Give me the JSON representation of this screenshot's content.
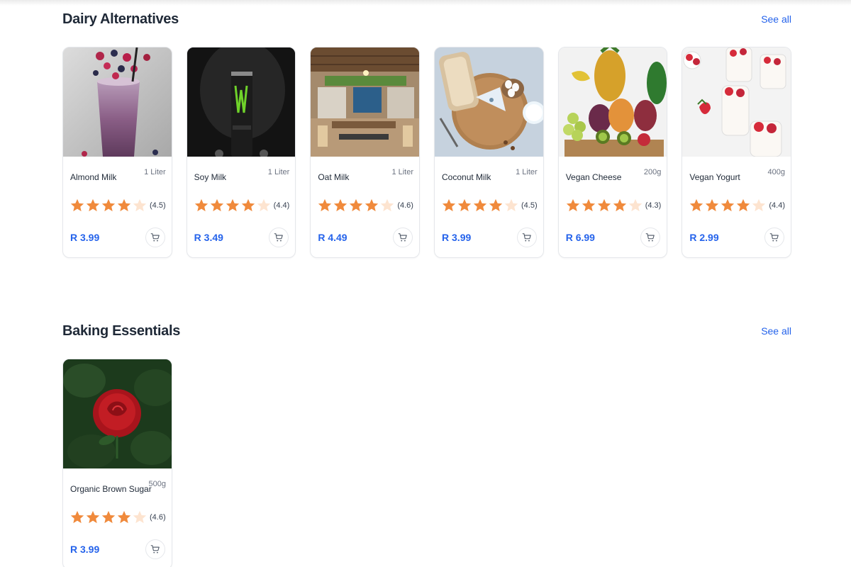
{
  "sections": [
    {
      "title": "Dairy Alternatives",
      "see_all": "See all",
      "products": [
        {
          "name": "Almond Milk",
          "size": "1 Liter",
          "rating": 4.5,
          "rating_label": "(4.5)",
          "price": "R 3.99",
          "image": "berry-smoothie"
        },
        {
          "name": "Soy Milk",
          "size": "1 Liter",
          "rating": 4.4,
          "rating_label": "(4.4)",
          "price": "R 3.49",
          "image": "energy-drink-can"
        },
        {
          "name": "Oat Milk",
          "size": "1 Liter",
          "rating": 4.6,
          "rating_label": "(4.6)",
          "price": "R 4.49",
          "image": "cafe-interior"
        },
        {
          "name": "Coconut Milk",
          "size": "1 Liter",
          "rating": 4.5,
          "rating_label": "(4.5)",
          "price": "R 3.99",
          "image": "bread-cheese-board"
        },
        {
          "name": "Vegan Cheese",
          "size": "200g",
          "rating": 4.3,
          "rating_label": "(4.3)",
          "price": "R 6.99",
          "image": "fruit-basket"
        },
        {
          "name": "Vegan Yogurt",
          "size": "400g",
          "rating": 4.4,
          "rating_label": "(4.4)",
          "price": "R 2.99",
          "image": "strawberry-yogurt-jars"
        }
      ]
    },
    {
      "title": "Baking Essentials",
      "see_all": "See all",
      "products": [
        {
          "name": "Organic Brown Sugar",
          "size": "500g",
          "rating": 4.6,
          "rating_label": "(4.6)",
          "price": "R 3.99",
          "image": "red-rose"
        }
      ]
    }
  ],
  "colors": {
    "accent": "#2563eb",
    "star_filled": "#f08a3c",
    "star_empty": "#fde4d0",
    "title": "#1f2937"
  },
  "icons": {
    "star": "star-icon",
    "cart": "cart-icon"
  }
}
